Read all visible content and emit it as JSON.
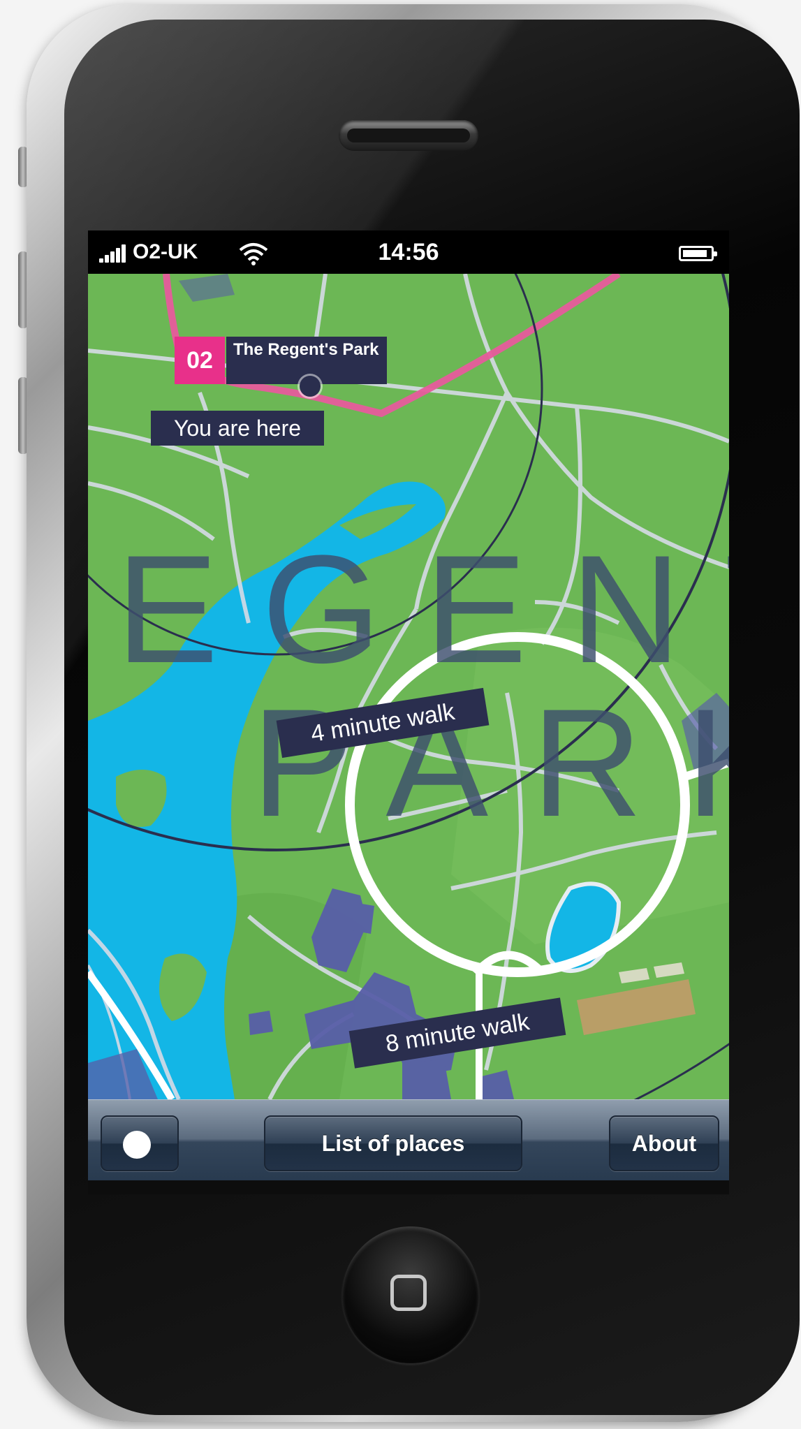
{
  "status_bar": {
    "carrier": "O2-UK",
    "time": "14:56"
  },
  "map": {
    "place_number": "02",
    "place_name": "The Regent's Park",
    "you_are_here": "You are here",
    "area_label_line1": "EGENT",
    "area_label_line2": "PARK",
    "walk_ring_inner": "4 minute walk",
    "walk_ring_outer": "8 minute walk",
    "colors": {
      "grass": "#6cb755",
      "water": "#13b6e6",
      "road": "#d6dbe6",
      "buildings": "#585ea8",
      "route": "#e75b9c",
      "label_bg": "#2a2e4e",
      "marker_pink": "#e8308a"
    }
  },
  "toolbar": {
    "locate_icon": "current-location-icon",
    "list_label": "List of places",
    "about_label": "About"
  },
  "device": {
    "home_icon": "home-button-icon"
  }
}
